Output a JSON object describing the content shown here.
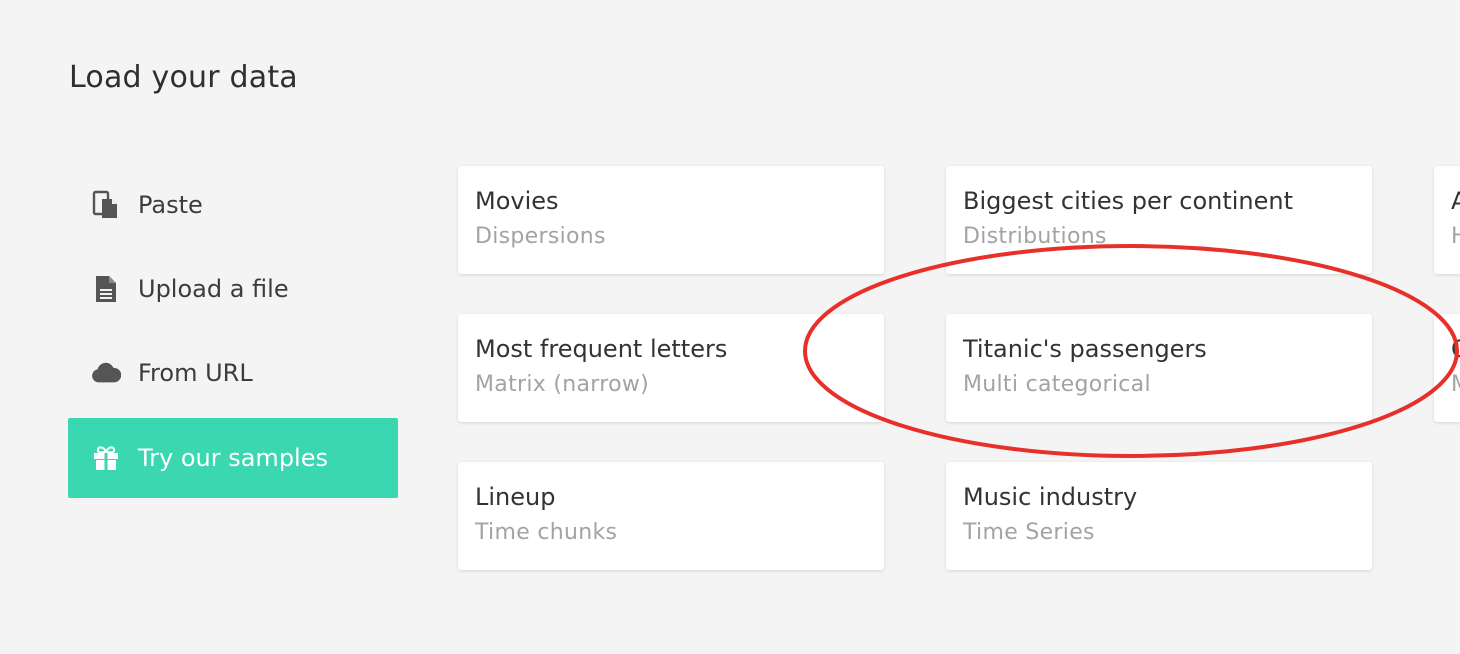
{
  "header": {
    "title": "Load your data"
  },
  "sidebar": {
    "items": [
      {
        "label": "Paste",
        "icon": "paste-icon"
      },
      {
        "label": "Upload a file",
        "icon": "file-icon"
      },
      {
        "label": "From URL",
        "icon": "cloud-icon"
      },
      {
        "label": "Try our samples",
        "icon": "gift-icon",
        "active": true
      }
    ]
  },
  "samples": {
    "col1": [
      {
        "name": "Movies",
        "type": "Dispersions"
      },
      {
        "name": "Most frequent letters",
        "type": "Matrix (narrow)"
      },
      {
        "name": "Lineup",
        "type": "Time chunks"
      }
    ],
    "col2": [
      {
        "name": "Biggest cities per continent",
        "type": "Distributions"
      },
      {
        "name": "Titanic's passengers",
        "type": "Multi categorical"
      },
      {
        "name": "Music industry",
        "type": "Time Series"
      }
    ],
    "col3_partial": [
      {
        "name": "A",
        "type": "H"
      },
      {
        "name": "C",
        "type": "M"
      }
    ]
  },
  "colors": {
    "accent": "#3bd7b1",
    "annotation": "#e8302a",
    "background": "#f4f4f4"
  }
}
